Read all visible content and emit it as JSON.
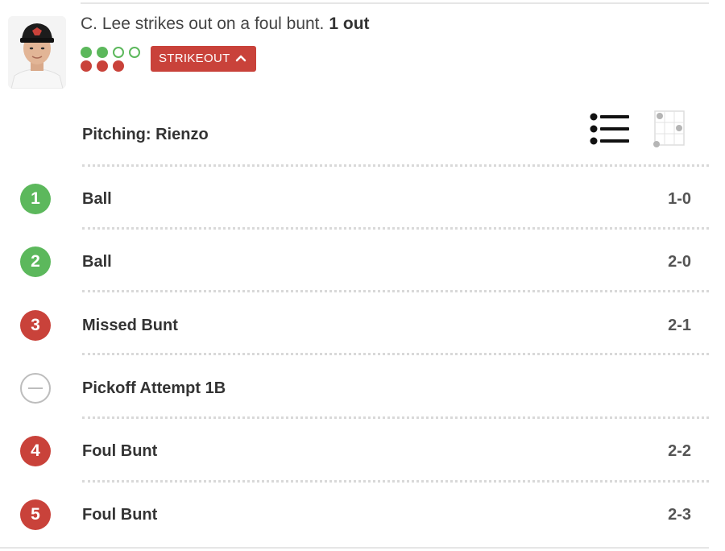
{
  "play": {
    "batter_name": "C. Lee",
    "description": "C. Lee strikes out on a foul bunt.",
    "outs_text": "1 out",
    "badge_label": "STRIKEOUT",
    "badge_icon": "chevron-up-icon",
    "count_display": {
      "balls_total": 4,
      "balls_filled": 2,
      "strikes_total": 3,
      "strikes_filled": 3
    }
  },
  "pitching": {
    "label": "Pitching: Rienzo"
  },
  "view_toggle": {
    "list_icon": "list-view-icon",
    "grid_icon": "strike-zone-grid-icon"
  },
  "pitches": [
    {
      "number": "1",
      "type": "ball",
      "description": "Ball",
      "count": "1-0"
    },
    {
      "number": "2",
      "type": "ball",
      "description": "Ball",
      "count": "2-0"
    },
    {
      "number": "3",
      "type": "strike",
      "description": "Missed Bunt",
      "count": "2-1"
    },
    {
      "number": "",
      "type": "neutral",
      "description": "Pickoff Attempt 1B",
      "count": ""
    },
    {
      "number": "4",
      "type": "strike",
      "description": "Foul Bunt",
      "count": "2-2"
    },
    {
      "number": "5",
      "type": "strike",
      "description": "Foul Bunt",
      "count": "2-3"
    }
  ],
  "colors": {
    "ball_green": "#5cb85c",
    "strike_red": "#c9423a",
    "neutral_gray": "#bdbdbd",
    "divider_gray": "#d9d9d9"
  }
}
